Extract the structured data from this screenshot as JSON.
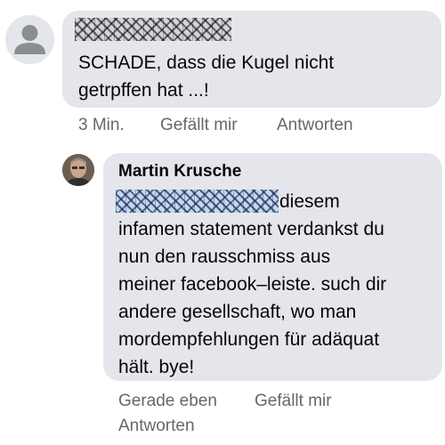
{
  "comment1": {
    "avatar_icon": "default-user-avatar-icon",
    "text_lines": [
      "SCHADE, dass die Kugel nicht",
      "getrpffen hat ...!"
    ],
    "time": "3 Min.",
    "like_label": "Gefällt mir",
    "reply_label": "Antworten"
  },
  "reply": {
    "avatar_icon": "profile-photo-avatar",
    "author": "Martin Krusche",
    "text_first": "diesem",
    "text_lines": [
      "infamen statement verdankst du",
      "nun den rausschmiss aus",
      "meiner facebook–leiste. such dir",
      "andere gesellschaft, wo man",
      "mordempfehlungen für adäquat",
      "hält. bye!"
    ],
    "time": "Gerade eben",
    "like_label": "Gefällt mir",
    "reply_label": "Antworten"
  },
  "colors": {
    "bubble": "#e4e6eb",
    "text": "#050505",
    "meta": "#65676b"
  }
}
